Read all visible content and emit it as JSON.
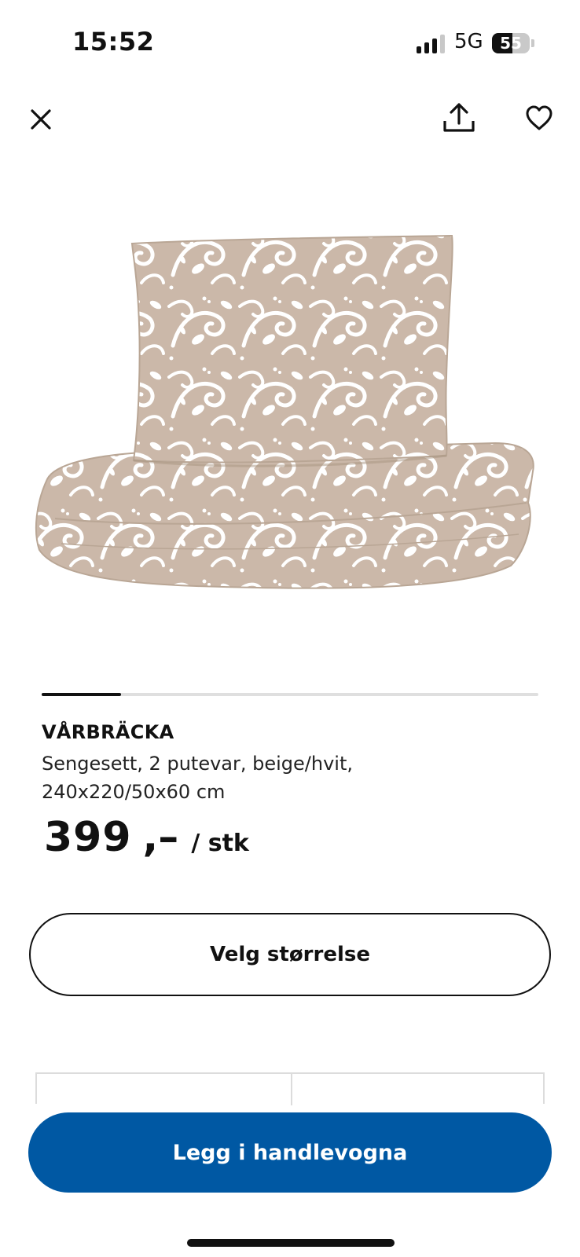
{
  "status_bar": {
    "time": "15:52",
    "network": "5G",
    "battery": "55",
    "battery_level": 0.55,
    "signal_bars_active": 3,
    "signal_bars_total": 4
  },
  "top_actions": {
    "close_icon": "close-icon",
    "share_icon": "share-icon",
    "favorite_icon": "heart-icon"
  },
  "product": {
    "image_alt": "bedding-set-image",
    "name": "VÅRBRÄCKA",
    "description": "Sengesett, 2 putevar, beige/hvit, 240x220/50x60 cm",
    "price_integer": "399",
    "price_decimal": ",–",
    "price_unit": "/ stk",
    "carousel_progress": 0.16,
    "pattern_colors": {
      "base": "#cbb8a9",
      "print": "#ffffff"
    }
  },
  "actions": {
    "select_size_label": "Velg størrelse",
    "add_to_cart_label": "Legg i handlevogna"
  },
  "colors": {
    "primary_blue": "#0058a3",
    "text": "#111111",
    "divider": "#dfdfdf"
  }
}
